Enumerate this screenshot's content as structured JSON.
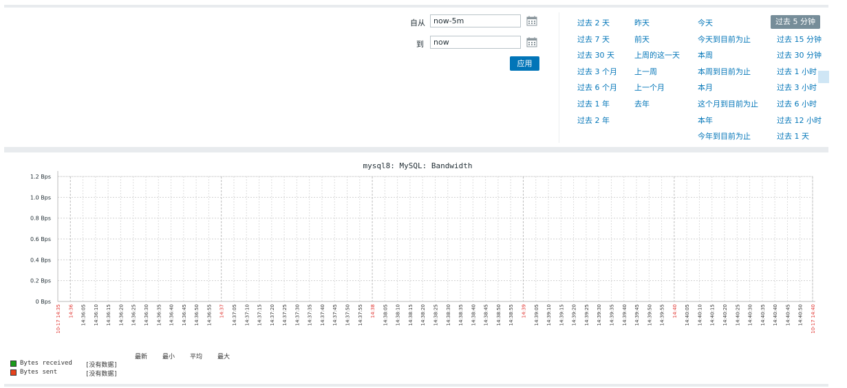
{
  "filter": {
    "from_label": "自从",
    "from_value": "now-5m",
    "to_label": "到",
    "to_value": "now",
    "apply_label": "应用"
  },
  "quick_ranges": {
    "col1": [
      "过去 2 天",
      "过去 7 天",
      "过去 30 天",
      "过去 3 个月",
      "过去 6 个月",
      "过去 1 年",
      "过去 2 年"
    ],
    "col2": [
      "昨天",
      "前天",
      "上周的这一天",
      "上一周",
      "上一个月",
      "去年"
    ],
    "col3": [
      "今天",
      "今天到目前为止",
      "本周",
      "本周到目前为止",
      "本月",
      "这个月到目前为止",
      "本年",
      "今年到目前为止"
    ],
    "col4": [
      "过去 5 分钟",
      "过去 15 分钟",
      "过去 30 分钟",
      "过去 1 小时",
      "过去 3 小时",
      "过去 6 小时",
      "过去 12 小时",
      "过去 1 天"
    ],
    "selected": "过去 5 分钟"
  },
  "legend": {
    "headers": [
      "最新",
      "最小",
      "平均",
      "最大"
    ],
    "items": [
      {
        "name": "Bytes received",
        "value": "[没有数据]",
        "color": "#1a9c1a"
      },
      {
        "name": "Bytes sent",
        "value": "[没有数据]",
        "color": "#e8421c"
      }
    ]
  },
  "chart_data": {
    "type": "line",
    "title": "mysql8: MySQL: Bandwidth",
    "y_ticks": [
      "0 Bps",
      "0.2 Bps",
      "0.4 Bps",
      "0.6 Bps",
      "0.8 Bps",
      "1.0 Bps",
      "1.2 Bps"
    ],
    "ylim": [
      0,
      1.2
    ],
    "x_ticks": [
      {
        "label": "10-17 14:35",
        "major": true
      },
      {
        "label": "14:36",
        "major": true
      },
      {
        "label": "14:36:05"
      },
      {
        "label": "14:36:10"
      },
      {
        "label": "14:36:15"
      },
      {
        "label": "14:36:20"
      },
      {
        "label": "14:36:25"
      },
      {
        "label": "14:36:30"
      },
      {
        "label": "14:36:35"
      },
      {
        "label": "14:36:40"
      },
      {
        "label": "14:36:45"
      },
      {
        "label": "14:36:50"
      },
      {
        "label": "14:36:55"
      },
      {
        "label": "14:37",
        "major": true
      },
      {
        "label": "14:37:05"
      },
      {
        "label": "14:37:10"
      },
      {
        "label": "14:37:15"
      },
      {
        "label": "14:37:20"
      },
      {
        "label": "14:37:25"
      },
      {
        "label": "14:37:30"
      },
      {
        "label": "14:37:35"
      },
      {
        "label": "14:37:40"
      },
      {
        "label": "14:37:45"
      },
      {
        "label": "14:37:50"
      },
      {
        "label": "14:37:55"
      },
      {
        "label": "14:38",
        "major": true
      },
      {
        "label": "14:38:05"
      },
      {
        "label": "14:38:10"
      },
      {
        "label": "14:38:15"
      },
      {
        "label": "14:38:20"
      },
      {
        "label": "14:38:25"
      },
      {
        "label": "14:38:30"
      },
      {
        "label": "14:38:35"
      },
      {
        "label": "14:38:40"
      },
      {
        "label": "14:38:45"
      },
      {
        "label": "14:38:50"
      },
      {
        "label": "14:38:55"
      },
      {
        "label": "14:39",
        "major": true
      },
      {
        "label": "14:39:05"
      },
      {
        "label": "14:39:10"
      },
      {
        "label": "14:39:15"
      },
      {
        "label": "14:39:20"
      },
      {
        "label": "14:39:25"
      },
      {
        "label": "14:39:30"
      },
      {
        "label": "14:39:35"
      },
      {
        "label": "14:39:40"
      },
      {
        "label": "14:39:45"
      },
      {
        "label": "14:39:50"
      },
      {
        "label": "14:39:55"
      },
      {
        "label": "14:40",
        "major": true
      },
      {
        "label": "14:40:05"
      },
      {
        "label": "14:40:10"
      },
      {
        "label": "14:40:15"
      },
      {
        "label": "14:40:20"
      },
      {
        "label": "14:40:25"
      },
      {
        "label": "14:40:30"
      },
      {
        "label": "14:40:35"
      },
      {
        "label": "14:40:40"
      },
      {
        "label": "14:40:45"
      },
      {
        "label": "14:40:50"
      },
      {
        "label": "10-17 14:40",
        "major": true
      }
    ],
    "series": [
      {
        "name": "Bytes received",
        "values": []
      },
      {
        "name": "Bytes sent",
        "values": []
      }
    ],
    "grid": true,
    "major_tick_color": "#e0312d",
    "minor_tick_color": "#333333"
  }
}
